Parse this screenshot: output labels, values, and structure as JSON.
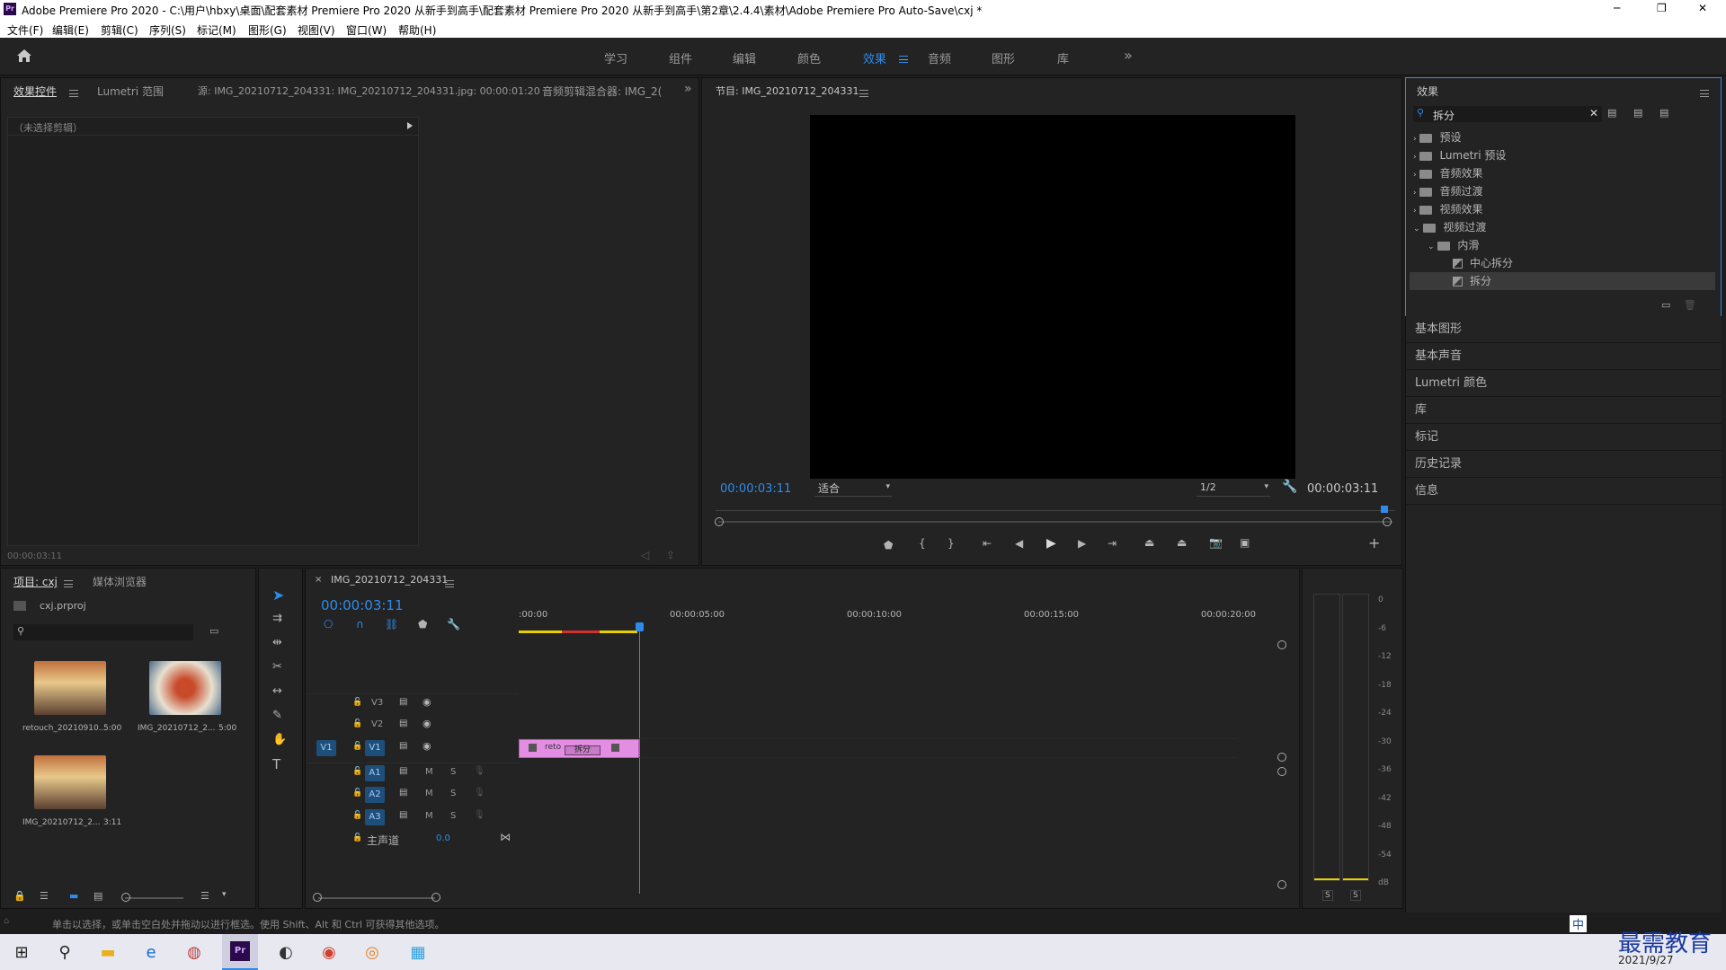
{
  "window": {
    "app_icon_label": "Pr",
    "title": "Adobe Premiere Pro 2020 - C:\\用户\\hbxy\\桌面\\配套素材 Premiere Pro 2020 从新手到高手\\配套素材 Premiere Pro 2020 从新手到高手\\第2章\\2.4.4\\素材\\Adobe Premiere Pro Auto-Save\\cxj *",
    "controls": [
      "─",
      "❐",
      "✕"
    ]
  },
  "menu": [
    "文件(F)",
    "编辑(E)",
    "剪辑(C)",
    "序列(S)",
    "标记(M)",
    "图形(G)",
    "视图(V)",
    "窗口(W)",
    "帮助(H)"
  ],
  "workspaces": {
    "tabs": [
      "学习",
      "组件",
      "编辑",
      "颜色",
      "效果",
      "音频",
      "图形",
      "库"
    ],
    "active": "效果",
    "more": "»"
  },
  "source_panel": {
    "tabs": [
      "效果控件",
      "Lumetri 范围",
      "源: IMG_20210712_204331: IMG_20210712_204331.jpg: 00:00:01:20",
      "音频剪辑混合器: IMG_2("
    ],
    "no_clip": "（未选择剪辑）",
    "timecode": "00:00:03:11"
  },
  "program_monitor": {
    "title": "节目: IMG_20210712_204331",
    "timecode_left": "00:00:03:11",
    "fit": "适合",
    "resolution": "1/2",
    "timecode_right": "00:00:03:11"
  },
  "effects_panel": {
    "title": "效果",
    "search_value": "拆分",
    "tree": [
      {
        "label": "预设",
        "level": 0,
        "open": false
      },
      {
        "label": "Lumetri 预设",
        "level": 0,
        "open": false
      },
      {
        "label": "音频效果",
        "level": 0,
        "open": false
      },
      {
        "label": "音频过渡",
        "level": 0,
        "open": false
      },
      {
        "label": "视频效果",
        "level": 0,
        "open": false
      },
      {
        "label": "视频过渡",
        "level": 0,
        "open": true
      },
      {
        "label": "内滑",
        "level": 1,
        "open": true
      },
      {
        "label": "中心拆分",
        "level": 2,
        "open": false
      },
      {
        "label": "拆分",
        "level": 2,
        "open": false,
        "selected": true
      }
    ]
  },
  "side_panels": [
    "基本图形",
    "基本声音",
    "Lumetri 颜色",
    "库",
    "标记",
    "历史记录",
    "信息"
  ],
  "project_panel": {
    "tabs": [
      "项目: cxj",
      "媒体浏览器"
    ],
    "project_file": "cxj.prproj",
    "items": [
      {
        "name": "retouch_20210910...",
        "duration": "5:00"
      },
      {
        "name": "IMG_20210712_2...",
        "duration": "5:00"
      },
      {
        "name": "IMG_20210712_2...",
        "duration": "3:11"
      }
    ]
  },
  "timeline": {
    "sequence_tab": "IMG_20210712_204331",
    "timecode": "00:00:03:11",
    "ruler": [
      ":00:00",
      "00:00:05:00",
      "00:00:10:00",
      "00:00:15:00",
      "00:00:20:00"
    ],
    "video_tracks": [
      "V3",
      "V2",
      "V1"
    ],
    "audio_tracks": [
      "A1",
      "A2",
      "A3"
    ],
    "source_patch": "V1",
    "master_label": "主声道",
    "master_value": "0.0",
    "clip_label": "reto",
    "transition_label": "拆分",
    "mute": "M",
    "solo": "S"
  },
  "audio_meter": {
    "scale": [
      "0",
      "-6",
      "-12",
      "-18",
      "-24",
      "-30",
      "-36",
      "-42",
      "-48",
      "-54",
      "dB"
    ],
    "solo_buttons": [
      "S",
      "S"
    ]
  },
  "status_bar": "单击以选择，或单击空白处并拖动以进行框选。使用 Shift、Alt 和 Ctrl 可获得其他选项。",
  "taskbar": {
    "watermark": "最需教育",
    "date": "2021/9/27",
    "ime_label": "中"
  },
  "colors": {
    "accent": "#2d8ceb",
    "clip_pink": "#e38ee3",
    "panel_bg": "#232323",
    "selected_row": "#3a3a3a"
  }
}
